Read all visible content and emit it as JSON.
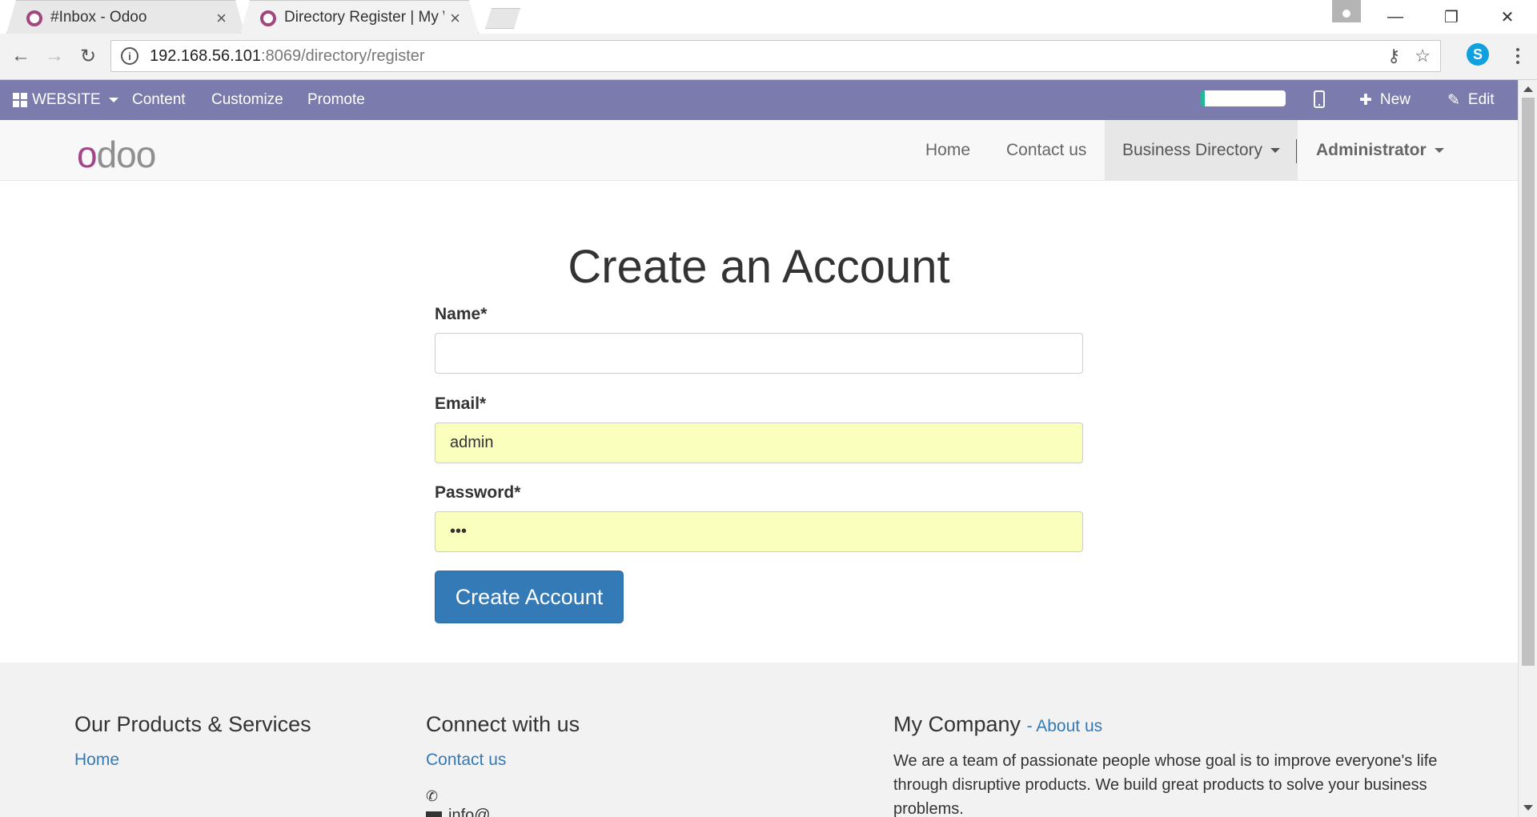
{
  "browser": {
    "tabs": [
      {
        "title": "#Inbox - Odoo",
        "active": false
      },
      {
        "title": "Directory Register | My W",
        "active": true
      }
    ],
    "url_host": "192.168.56.101",
    "url_path": ":8069/directory/register",
    "icons": {
      "back": "←",
      "forward": "→",
      "reload": "↻",
      "info": "i",
      "close": "×",
      "minimize": "—",
      "restore": "❐",
      "window_close": "✕",
      "key": "⚷",
      "star": "☆",
      "skype": "S"
    }
  },
  "adminbar": {
    "website": "WEBSITE",
    "content": "Content",
    "customize": "Customize",
    "promote": "Promote",
    "new": "New",
    "new_icon": "✚",
    "edit": "Edit",
    "edit_icon": "✎",
    "color": "#7c7bad"
  },
  "header": {
    "logo": {
      "o": "o",
      "rest": "doo"
    },
    "nav": {
      "home": "Home",
      "contact": "Contact us",
      "directory": "Business Directory",
      "user": "Administrator"
    }
  },
  "form": {
    "title": "Create an Account",
    "name_label": "Name*",
    "name_value": "",
    "email_label": "Email*",
    "email_value": "admin",
    "password_label": "Password*",
    "password_value": "•••",
    "submit": "Create Account",
    "button_color": "#337ab7",
    "autofill_color": "#faffbd"
  },
  "footer": {
    "col1_title": "Our Products & Services",
    "col1_link": "Home",
    "col2_title": "Connect with us",
    "col2_link": "Contact us",
    "phone_icon": "✆",
    "col2_mail": "info@...",
    "col3_title": "My Company",
    "col3_sub": "- About us",
    "col3_text": "We are a team of passionate people whose goal is to improve everyone's life through disruptive products. We build great products to solve your business problems."
  }
}
